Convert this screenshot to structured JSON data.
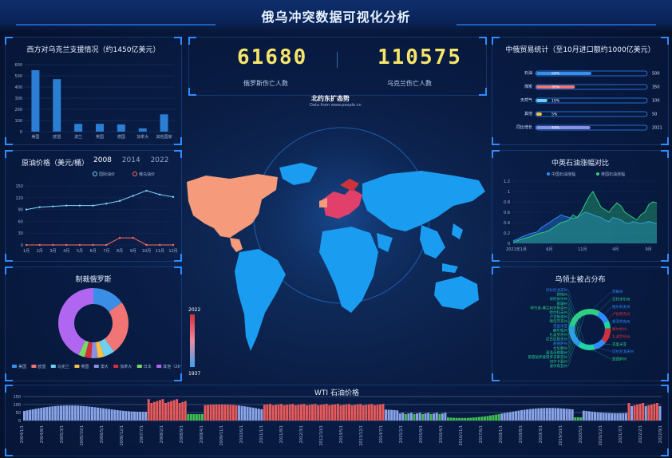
{
  "page": {
    "title": "俄乌冲突数据可视化分析"
  },
  "kpis": [
    {
      "value": "61680",
      "label": "俄罗斯伤亡人数"
    },
    {
      "value": "110575",
      "label": "乌克兰伤亡人数"
    }
  ],
  "map": {
    "title": "北约东扩态势",
    "subtitle": "Data from www.people.cn",
    "scale_max": "2022",
    "scale_min": "1937"
  },
  "colors": {
    "accent": "#2f8cff",
    "kpi": "#f7e56a",
    "bar_blue": "#2a7fd4",
    "salmon": "#f59b7b",
    "russia_red": "#d0323c",
    "nato_red": "#e0406a",
    "ocean_blue": "#1a9cf0"
  },
  "chart_data": [
    {
      "id": "west-support",
      "type": "bar",
      "title": "西方对乌克兰支援情况（约1450亿美元）",
      "categories": [
        "美国",
        "欧盟",
        "波兰",
        "英国",
        "德国",
        "加拿大",
        "其他国家"
      ],
      "values": [
        550,
        470,
        70,
        70,
        65,
        30,
        155
      ],
      "ylim": [
        0,
        600
      ],
      "yticks": [
        0,
        100,
        200,
        300,
        400,
        500,
        600
      ]
    },
    {
      "id": "oil-price",
      "type": "line",
      "title": "原油价格（美元/桶）",
      "year_tabs": [
        "2008",
        "2014",
        "2022"
      ],
      "active_tab": "2008",
      "categories": [
        "1月",
        "2月",
        "3月",
        "4月",
        "5月",
        "6月",
        "7月",
        "8月",
        "9月",
        "10月",
        "11月",
        "12月"
      ],
      "series": [
        {
          "name": "国际油价",
          "values": [
            90,
            96,
            98,
            100,
            100,
            100,
            105,
            112,
            125,
            138,
            128,
            122
          ],
          "color": "#7fd6ff"
        },
        {
          "name": "俄乌油价",
          "values": [
            0,
            0,
            0,
            0,
            0,
            0,
            0,
            18,
            18,
            0,
            0,
            0
          ],
          "color": "#ff6f61"
        }
      ],
      "ylim": [
        0,
        150
      ],
      "yticks": [
        0,
        30,
        60,
        90,
        120,
        150
      ]
    },
    {
      "id": "sanctions",
      "type": "pie",
      "title": "制裁俄罗斯",
      "slices": [
        {
          "name": "美国",
          "value": 15,
          "color": "#3a8ee6"
        },
        {
          "name": "欧盟",
          "value": 25,
          "color": "#f27575"
        },
        {
          "name": "乌克兰",
          "value": 5,
          "color": "#6ed0f0"
        },
        {
          "name": "英国",
          "value": 3,
          "color": "#f5c04a"
        },
        {
          "name": "澳大",
          "value": 3,
          "color": "#8b8fe0"
        },
        {
          "name": "加拿大",
          "value": 3,
          "color": "#d4303a"
        },
        {
          "name": "日本",
          "value": 3,
          "color": "#7ad86a"
        },
        {
          "name": "其他（26个国家）",
          "value": 43,
          "color": "#b066f0"
        }
      ]
    },
    {
      "id": "china-russia-trade",
      "type": "bar",
      "title": "中俄贸易统计（至10月进口额约1000亿美元）",
      "rows": [
        {
          "name": "石油",
          "pct": "50%",
          "fill": 0.5,
          "total": "500",
          "color": "#3a8ee6"
        },
        {
          "name": "煤炭",
          "pct": "35%",
          "fill": 0.35,
          "total": "350",
          "color": "#f27575"
        },
        {
          "name": "天然气",
          "pct": "10%",
          "fill": 0.1,
          "total": "100",
          "color": "#6ed0f0"
        },
        {
          "name": "其他",
          "pct": "5%",
          "fill": 0.05,
          "total": "50",
          "color": "#f5c04a"
        },
        {
          "name": "同比增长",
          "pct": "49%",
          "fill": 0.49,
          "total": "2021",
          "color": "#8b8fe0"
        }
      ]
    },
    {
      "id": "cn-uk-oil",
      "type": "area",
      "title": "中英石油涨幅对比",
      "series": [
        {
          "name": "中国石油涨幅",
          "color": "#2f8cff",
          "values": [
            0.05,
            0.08,
            0.12,
            0.15,
            0.18,
            0.2,
            0.22,
            0.3,
            0.35,
            0.4,
            0.45,
            0.5,
            0.55,
            0.52,
            0.5,
            0.48,
            0.5,
            0.55,
            0.6,
            0.58,
            0.55,
            0.52,
            0.5,
            0.45,
            0.42,
            0.5,
            0.48,
            0.45,
            0.4,
            0.38,
            0.42,
            0.4,
            0.38,
            0.4,
            0.42,
            0.4,
            0.38
          ]
        },
        {
          "name": "英国石油涨幅",
          "color": "#2fcf7f",
          "values": [
            0.02,
            0.05,
            0.08,
            0.1,
            0.12,
            0.15,
            0.18,
            0.2,
            0.22,
            0.25,
            0.3,
            0.35,
            0.4,
            0.42,
            0.45,
            0.55,
            0.5,
            0.6,
            0.75,
            0.9,
            1.0,
            0.85,
            0.7,
            0.65,
            0.6,
            0.7,
            0.78,
            0.72,
            0.6,
            0.55,
            0.5,
            0.45,
            0.55,
            0.6,
            0.75,
            0.8,
            0.78
          ]
        }
      ],
      "x_ticks": [
        "2021年1月",
        "6月",
        "11月",
        "4月",
        "9月"
      ],
      "ylim": [
        0,
        1.2
      ],
      "yticks": [
        0,
        0.2,
        0.4,
        0.6,
        0.8,
        1,
        1.2
      ]
    },
    {
      "id": "occupied",
      "type": "pie",
      "title": "乌领土被占分布",
      "labels_left": [
        "切尔尼戈夫州",
        "苏梅州",
        "日托米尔州",
        "基辅州",
        "伊万诺-弗兰科夫斯克州",
        "哈尔科夫州",
        "卢甘斯克州",
        "顿涅茨克州",
        "克里米亚",
        "赫尔松州",
        "扎波罗热州",
        "尼古拉耶夫州",
        "敖德萨州",
        "文尼察州",
        "基洛沃格勒州",
        "第聂伯罗彼得罗夫斯克州",
        "切尔卡瑟州",
        "波尔塔瓦州"
      ],
      "labels_right": [
        "苏梅州",
        "日托米尔州",
        "哈尔科夫州",
        "卢甘斯克州",
        "顿涅茨克州",
        "赫尔松州",
        "扎波罗热州",
        "克里米亚",
        "切尔尼戈夫州",
        "敖德萨州"
      ],
      "slices": [
        {
          "value": 8,
          "color": "#2fcf7f"
        },
        {
          "value": 10,
          "color": "#2f8cff"
        },
        {
          "value": 6,
          "color": "#1ed6a0"
        },
        {
          "value": 12,
          "color": "#d4303a"
        },
        {
          "value": 10,
          "color": "#2f8cff"
        },
        {
          "value": 14,
          "color": "#1ed6a0"
        },
        {
          "value": 18,
          "color": "#2f8cff"
        },
        {
          "value": 22,
          "color": "#2fcf7f"
        }
      ]
    },
    {
      "id": "wti",
      "type": "bar",
      "title": "WTI 石油价格",
      "x_labels": [
        "2004/1/1",
        "2004/8/1",
        "2005/3/1",
        "2005/10/1",
        "2006/5/1",
        "2006/12/1",
        "2007/7/1",
        "2008/2/1",
        "2008/9/1",
        "2009/4/1",
        "2009/11/1",
        "2010/6/1",
        "2011/1/1",
        "2011/8/1",
        "2012/3/1",
        "2012/10/1",
        "2013/5/1",
        "2013/12/1",
        "2014/7/1",
        "2015/2/1",
        "2015/9/1",
        "2016/4/1",
        "2016/11/1",
        "2017/6/1",
        "2018/1/1",
        "2018/8/1",
        "2019/3/1",
        "2019/10/1",
        "2020/5/1",
        "2020/12/1",
        "2021/7/1",
        "2022/2/1",
        "2022/9/1"
      ],
      "yticks": [
        0,
        50,
        100,
        150
      ],
      "ylim": [
        0,
        150
      ],
      "colors": {
        "normal": "#8aa4e8",
        "high": "#e85a5a",
        "low": "#3fbf4f"
      }
    }
  ]
}
